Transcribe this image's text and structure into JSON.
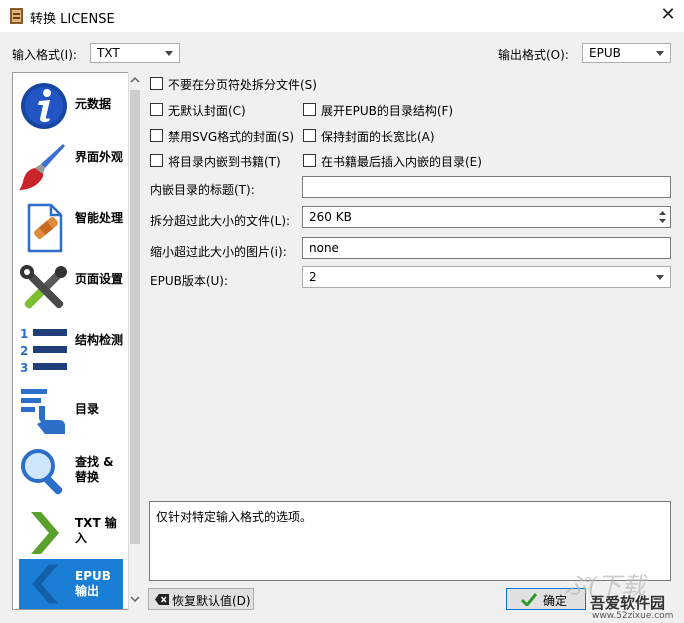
{
  "window": {
    "title": "转换 LICENSE",
    "close_symbol": "✕"
  },
  "input_format": {
    "label": "输入格式(I):",
    "value": "TXT"
  },
  "output_format": {
    "label": "输出格式(O):",
    "value": "EPUB"
  },
  "sidebar": {
    "items": [
      {
        "label": "元数据",
        "icon": "info-icon"
      },
      {
        "label": "界面外观",
        "icon": "brush-icon"
      },
      {
        "label": "智能处理",
        "icon": "document-bandage-icon"
      },
      {
        "label": "页面设置",
        "icon": "tools-icon"
      },
      {
        "label": "结构检测",
        "icon": "numbered-list-icon"
      },
      {
        "label": "目录",
        "icon": "toc-hand-icon"
      },
      {
        "label": "查找 & 替换",
        "icon": "magnifier-icon"
      },
      {
        "label": "TXT 输入",
        "icon": "chevron-right-icon"
      },
      {
        "label": "EPUB 输出",
        "icon": "chevron-left-icon",
        "selected": true
      }
    ]
  },
  "options": {
    "no_split_on_page_breaks": {
      "label": "不要在分页符处拆分文件(S)",
      "checked": false
    },
    "no_default_cover": {
      "label": "无默认封面(C)",
      "checked": false
    },
    "flatten_toc": {
      "label": "展开EPUB的目录结构(F)",
      "checked": false
    },
    "svg_cover": {
      "label": "禁用SVG格式的封面(S)",
      "checked": false
    },
    "preserve_aspect": {
      "label": "保持封面的长宽比(A)",
      "checked": false
    },
    "insert_toc": {
      "label": "将目录内嵌到书籍(T)",
      "checked": false
    },
    "toc_at_end": {
      "label": "在书籍最后插入内嵌的目录(E)",
      "checked": false
    }
  },
  "fields": {
    "toc_title": {
      "label": "内嵌目录的标题(T):",
      "value": ""
    },
    "split_size": {
      "label": "拆分超过此大小的文件(L):",
      "value": "260 KB"
    },
    "shrink_images": {
      "label": "缩小超过此大小的图片(i):",
      "value": "none"
    },
    "epub_version": {
      "label": "EPUB版本(U):",
      "value": "2"
    }
  },
  "description": "仅针对特定输入格式的选项。",
  "buttons": {
    "restore_defaults": "恢复默认值(D)",
    "ok": "确定"
  },
  "watermark": {
    "text": "吾爱软件园",
    "url": "www.52zixue.com"
  },
  "colors": {
    "selected_sidebar": "#1a7fd4",
    "accent": "#0078d7"
  }
}
